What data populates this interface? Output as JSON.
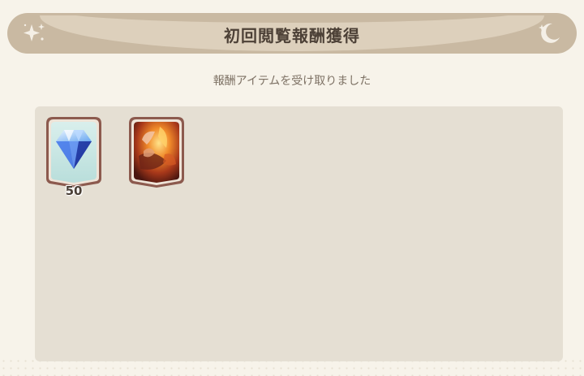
{
  "dialog": {
    "title": "初回閲覧報酬獲得",
    "subtitle": "報酬アイテムを受け取りました"
  },
  "rewards": [
    {
      "icon": "diamond-gem-icon",
      "quantity": "50"
    },
    {
      "icon": "character-card-icon",
      "quantity": ""
    }
  ],
  "colors": {
    "banner": "#c9b9a2",
    "panel": "#e5dfd3",
    "frame": "#8c5a4e",
    "gem_bg": "#c6e6e2"
  }
}
